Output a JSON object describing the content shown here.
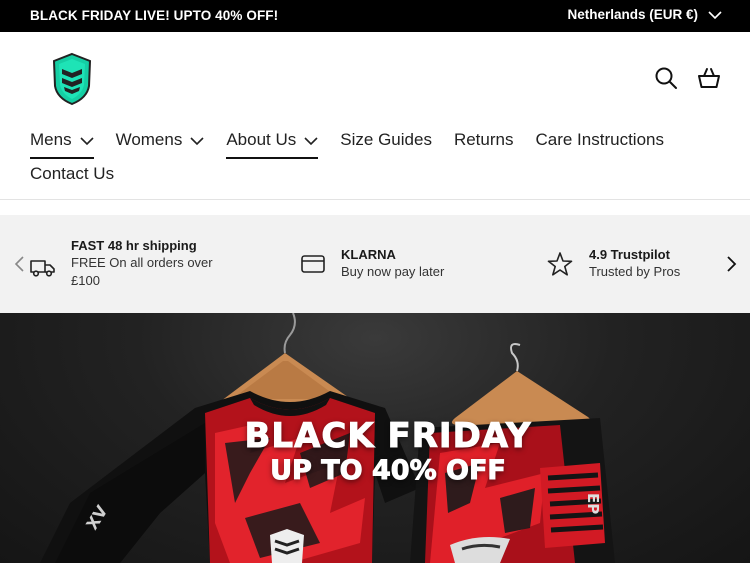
{
  "announcement": {
    "text": "BLACK FRIDAY LIVE! UPTO 40% OFF!",
    "locale": "Netherlands (EUR €)"
  },
  "header": {
    "logo_icon": "shield-logo-icon",
    "search_icon": "search-icon",
    "basket_icon": "basket-icon"
  },
  "nav": {
    "items": [
      {
        "label": "Mens",
        "dropdown": true
      },
      {
        "label": "Womens",
        "dropdown": true
      },
      {
        "label": "About Us",
        "dropdown": true
      },
      {
        "label": "Size Guides",
        "dropdown": false
      },
      {
        "label": "Returns",
        "dropdown": false
      },
      {
        "label": "Care Instructions",
        "dropdown": false
      },
      {
        "label": "Contact Us",
        "dropdown": false
      }
    ]
  },
  "usp": {
    "items": [
      {
        "icon": "truck-icon",
        "title": "FAST 48 hr shipping",
        "subtitle": "FREE On all orders over £100"
      },
      {
        "icon": "card-icon",
        "title": "KLARNA",
        "subtitle": "Buy now pay later"
      },
      {
        "icon": "star-icon",
        "title": "4.9 Trustpilot",
        "subtitle": "Trusted by Pros"
      }
    ]
  },
  "hero": {
    "title": "BLACK FRIDAY",
    "subtitle": "UP TO 40% OFF"
  },
  "colors": {
    "announcement_bg": "#000000",
    "logo_teal": "#1ee3b6",
    "usp_bg": "#f2f2f2",
    "kit_red": "#c8141e"
  }
}
